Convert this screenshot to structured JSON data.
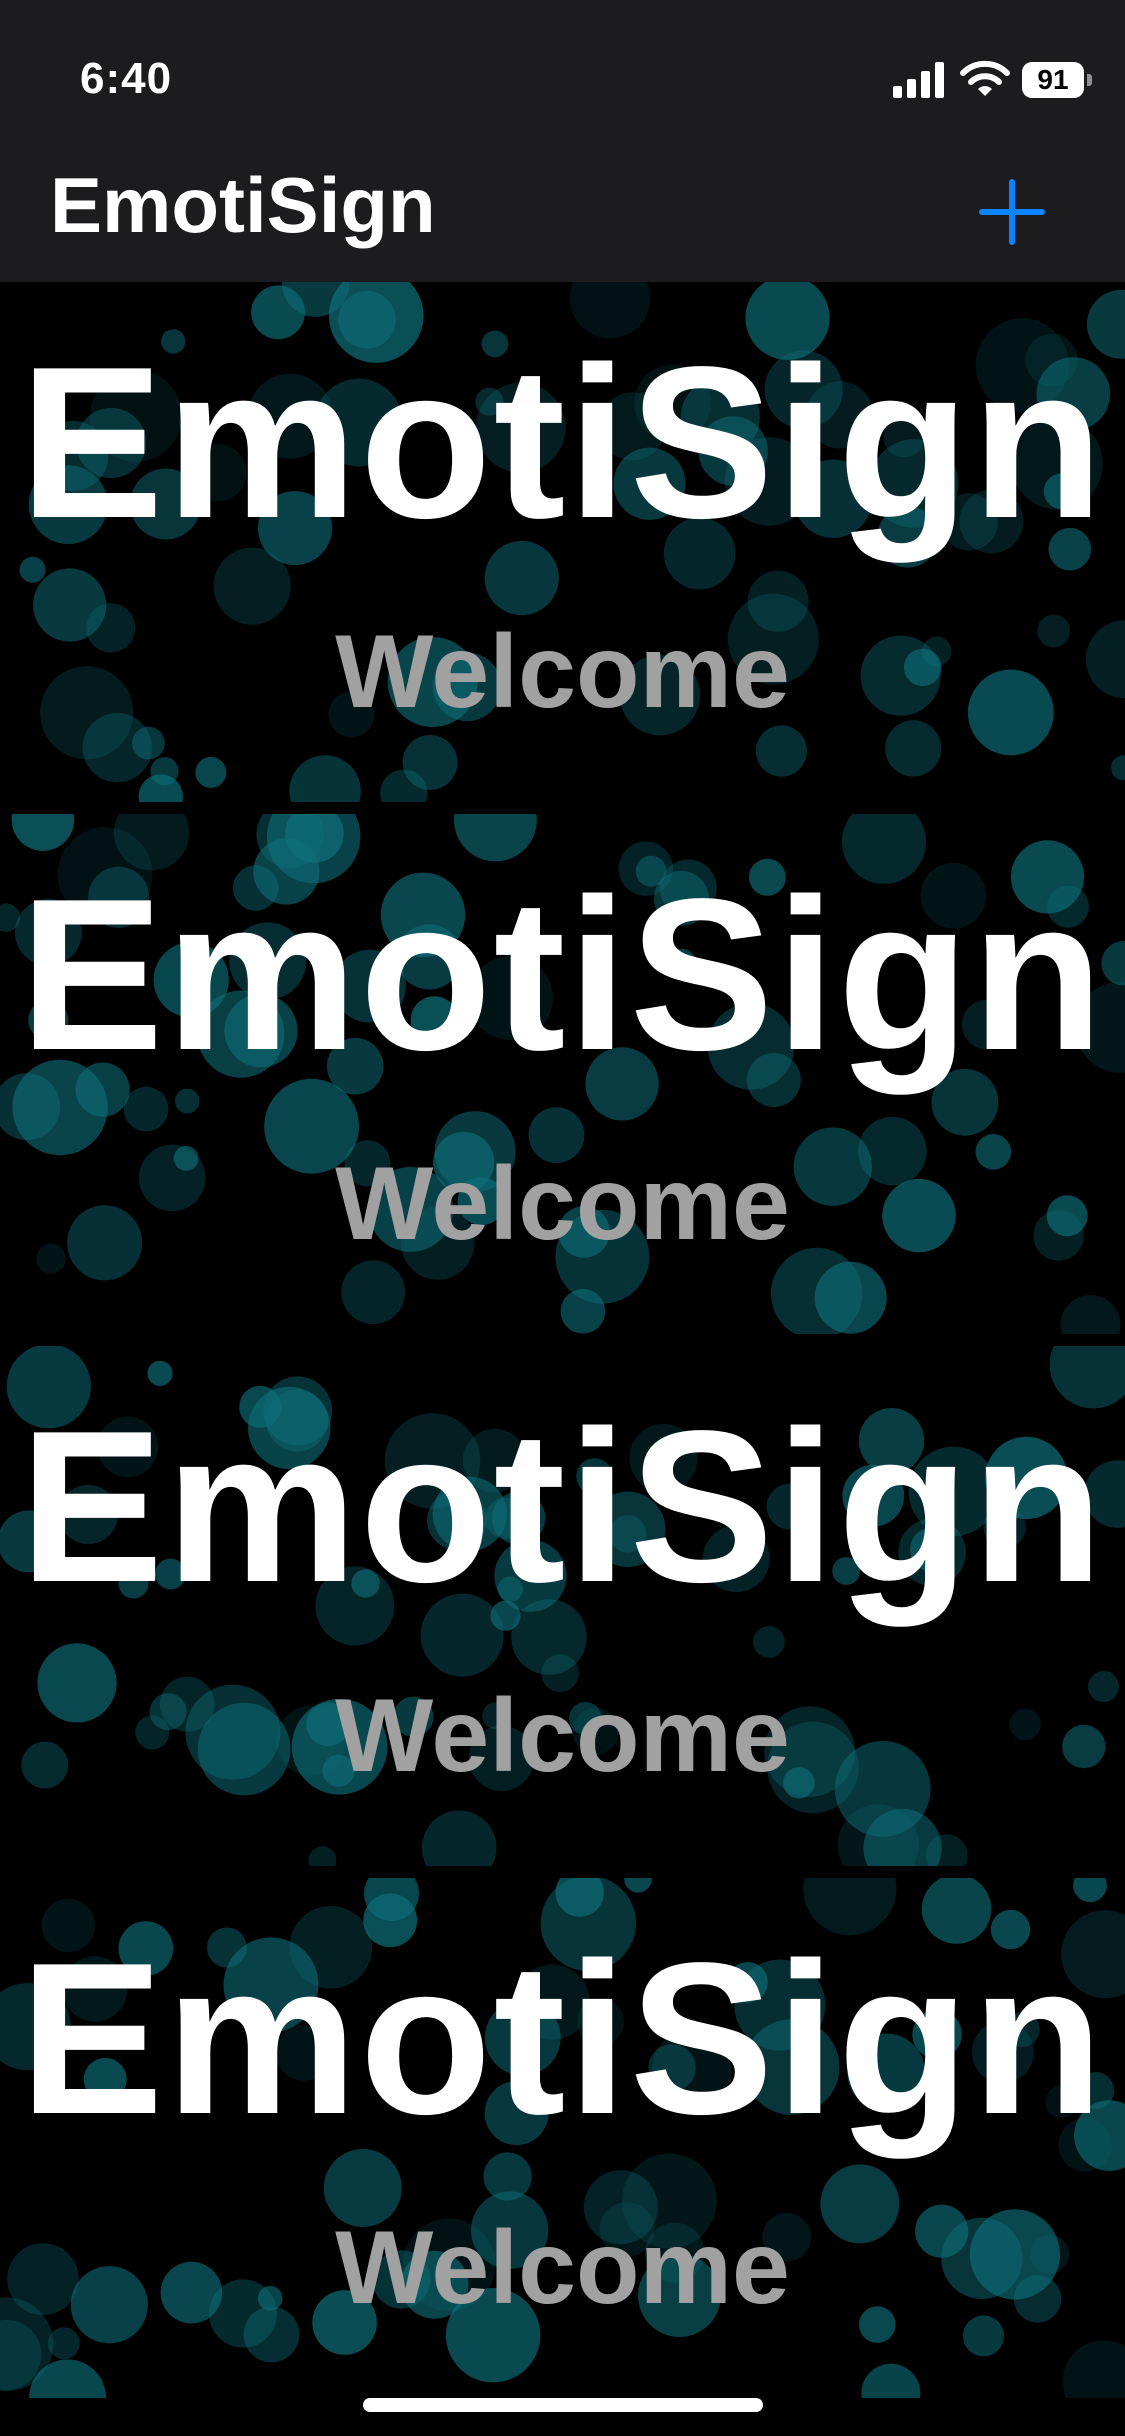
{
  "status_bar": {
    "time": "6:40",
    "battery_level": "91",
    "signal_icon": "cellular-signal-icon",
    "wifi_icon": "wifi-icon",
    "battery_icon": "battery-icon"
  },
  "nav": {
    "title": "EmotiSign",
    "add_icon": "plus-icon"
  },
  "colors": {
    "background": "#000000",
    "bar_background": "#1c1c1e",
    "accent": "#0a84ff",
    "bubble": "#0e6f7a",
    "subtitle": "#a1a1a1"
  },
  "cards": [
    {
      "title": "EmotiSign",
      "subtitle": "Welcome"
    },
    {
      "title": "EmotiSign",
      "subtitle": "Welcome"
    },
    {
      "title": "EmotiSign",
      "subtitle": "Welcome"
    },
    {
      "title": "EmotiSign",
      "subtitle": "Welcome"
    }
  ]
}
